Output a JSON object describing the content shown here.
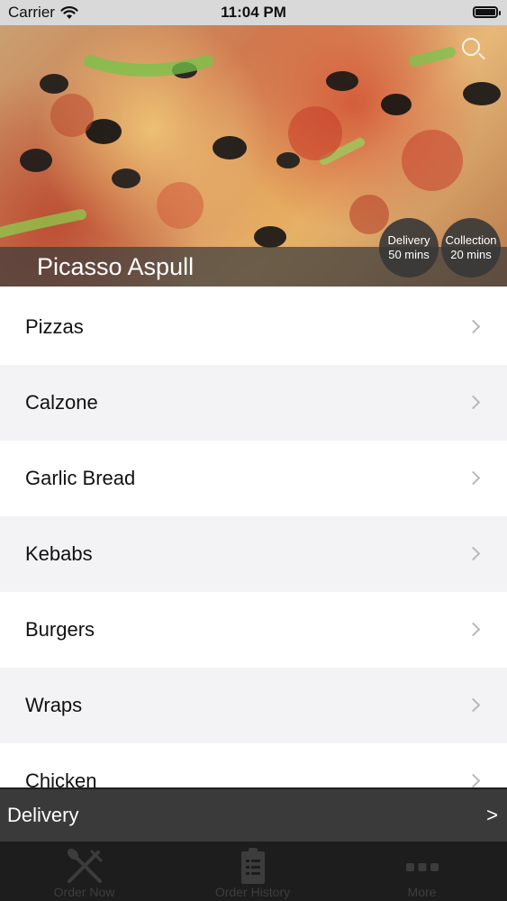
{
  "status_bar": {
    "carrier": "Carrier",
    "time": "11:04 PM"
  },
  "restaurant": {
    "name": "Picasso Aspull",
    "delivery": {
      "label": "Delivery",
      "time": "50 mins"
    },
    "collection": {
      "label": "Collection",
      "time": "20 mins"
    }
  },
  "menu": {
    "categories": [
      {
        "label": "Pizzas"
      },
      {
        "label": "Calzone"
      },
      {
        "label": "Garlic Bread"
      },
      {
        "label": "Kebabs"
      },
      {
        "label": "Burgers"
      },
      {
        "label": "Wraps"
      },
      {
        "label": "Chicken"
      }
    ]
  },
  "order_bar": {
    "mode": "Delivery",
    "arrow": ">"
  },
  "tabs": [
    {
      "label": "Order Now",
      "icon": "fork-knife-icon"
    },
    {
      "label": "Order History",
      "icon": "receipt-icon"
    },
    {
      "label": "More",
      "icon": "more-dots-icon"
    }
  ],
  "colors": {
    "status_bar_bg": "#d9d9d9",
    "badge_bg": "#373737",
    "alt_row_bg": "#f3f3f5",
    "order_bar_bg": "#3a3a3a",
    "tab_bar_bg": "#1d1d1d"
  }
}
